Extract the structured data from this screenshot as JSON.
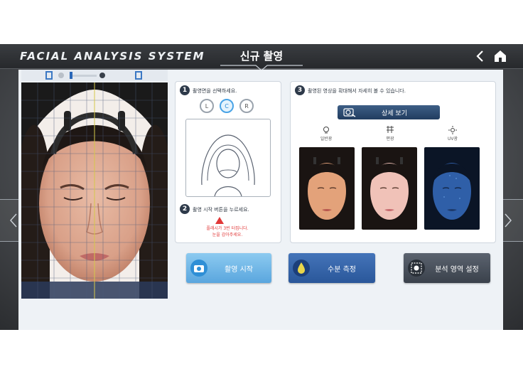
{
  "header": {
    "brand": "FACIAL ANALYSIS SYSTEM",
    "title": "신규 촬영",
    "back_icon": "back-chevron-icon",
    "home_icon": "home-icon"
  },
  "step1": {
    "number": "1",
    "instruction": "촬영면을 선택하세요.",
    "directions": [
      "L",
      "C",
      "R"
    ],
    "selected": "C"
  },
  "step2": {
    "number": "2",
    "instruction": "촬영 시작 버튼을 누르세요.",
    "warning_line1": "플래시가 3번 터집니다.",
    "warning_line2": "눈을 감아주세요."
  },
  "step3": {
    "number": "3",
    "instruction": "촬영된 영상을 확대해서 자세히 볼 수 있습니다.",
    "detail_button": "상세 보기",
    "modes": [
      {
        "label": "일반광",
        "icon": "bulb-icon"
      },
      {
        "label": "편광",
        "icon": "polarized-icon"
      },
      {
        "label": "UV광",
        "icon": "sun-icon"
      }
    ]
  },
  "actions": {
    "start": "촬영 시작",
    "moisture": "수분 측정",
    "area": "분석 영역 설정"
  },
  "colors": {
    "accent": "#3b78c4",
    "warning": "#e13838",
    "start_btn": "#6db7e6",
    "moisture_btn": "#3566ac",
    "area_btn": "#4a515c"
  }
}
